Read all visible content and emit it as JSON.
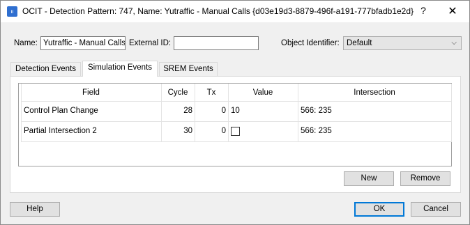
{
  "window": {
    "title": "OCIT - Detection Pattern: 747, Name: Yutraffic - Manual Calls  {d03e19d3-8879-496f-a191-777bfadb1e2d}",
    "app_icon_text": "ıı",
    "help_glyph": "?",
    "close_glyph": "✕"
  },
  "form": {
    "name_label": "Name:",
    "name_value": "Yutraffic - Manual Calls",
    "external_id_label": "External ID:",
    "external_id_value": "",
    "object_identifier_label": "Object Identifier:",
    "object_identifier_value": "Default"
  },
  "tabs": [
    {
      "label": "Detection Events",
      "active": false
    },
    {
      "label": "Simulation Events",
      "active": true
    },
    {
      "label": "SREM Events",
      "active": false
    }
  ],
  "table": {
    "columns": [
      "Field",
      "Cycle",
      "Tx",
      "Value",
      "Intersection"
    ],
    "rows": [
      {
        "field": "Control Plan Change",
        "cycle": "28",
        "tx": "0",
        "value": "10",
        "value_is_checkbox": false,
        "intersection": "566: 235"
      },
      {
        "field": "Partial Intersection 2",
        "cycle": "30",
        "tx": "0",
        "value": "",
        "value_is_checkbox": true,
        "checked": false,
        "intersection": "566: 235"
      }
    ]
  },
  "buttons": {
    "new": "New",
    "remove": "Remove",
    "help": "Help",
    "ok": "OK",
    "cancel": "Cancel"
  },
  "colors": {
    "accent": "#0078d7",
    "app_icon": "#2f6fd0"
  }
}
